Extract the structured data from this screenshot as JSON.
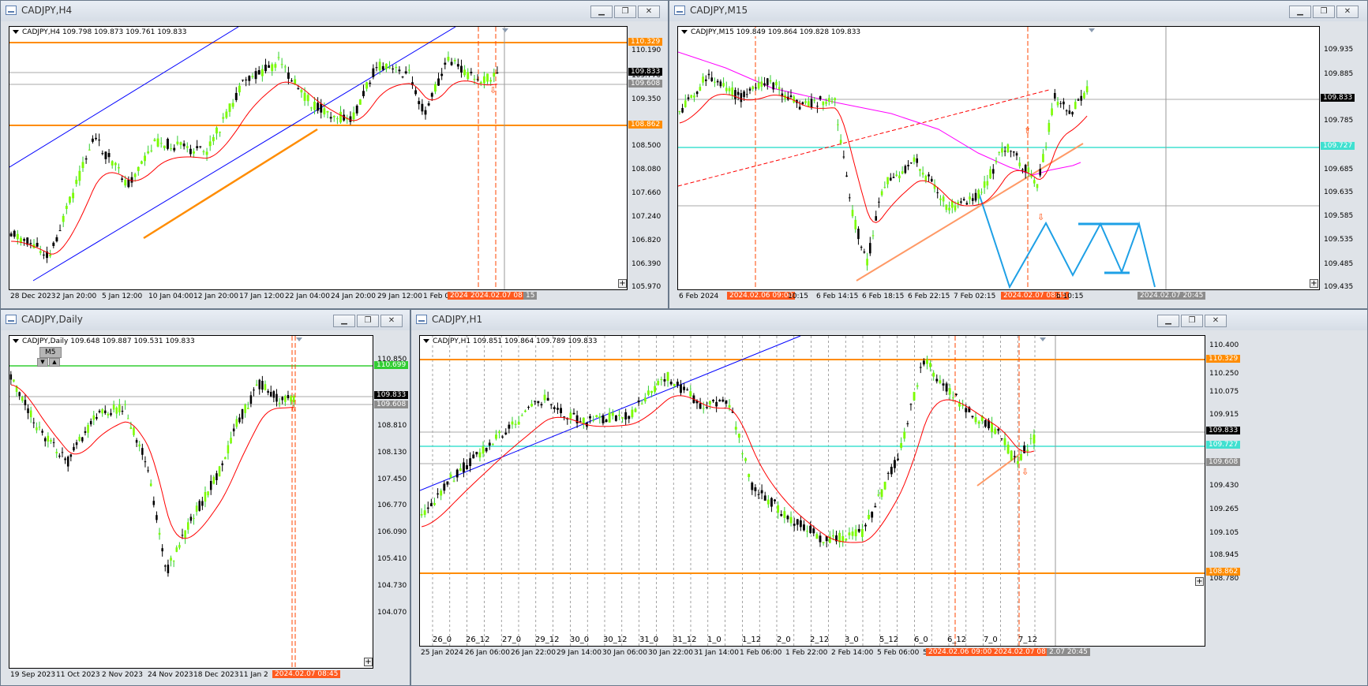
{
  "windows": [
    {
      "id": "h4",
      "title": "CADJPY,H4",
      "header": "CADJPY,H4  109.798 109.873 109.761 109.833",
      "ticks": [
        "110.190",
        "109.770",
        "109.350",
        "108.930",
        "108.500",
        "108.080",
        "107.660",
        "107.240",
        "106.820",
        "106.390",
        "105.970"
      ],
      "price_labels": [
        {
          "text": "110.329",
          "kind": "orange"
        },
        {
          "text": "109.833",
          "kind": "black"
        },
        {
          "text": "109.608",
          "kind": "gray"
        },
        {
          "text": "108.862",
          "kind": "orange"
        }
      ],
      "xticks": [
        "28 Dec 2023",
        "2 Jan 20:00",
        "5 Jan 12:00",
        "10 Jan 04:00",
        "12 Jan 20:00",
        "17 Jan 12:00",
        "22 Jan 04:00",
        "24 Jan 20:00",
        "29 Jan 12:00",
        "1 Feb 04"
      ],
      "xlabels": [
        {
          "text": "2024",
          "kind": "orange"
        },
        {
          "text": "2024.02.07 08:45",
          "kind": "orange"
        },
        {
          "text": "15",
          "kind": "gray"
        }
      ]
    },
    {
      "id": "m15",
      "title": "CADJPY,M15",
      "header": "CADJPY,M15  109.849 109.864 109.828 109.833",
      "ticks": [
        "109.935",
        "109.885",
        "109.835",
        "109.785",
        "109.735",
        "109.685",
        "109.635",
        "109.585",
        "109.535",
        "109.485",
        "109.435"
      ],
      "price_labels": [
        {
          "text": "109.833",
          "kind": "black"
        },
        {
          "text": "109.727",
          "kind": "cyan"
        }
      ],
      "xticks": [
        "6 Feb 2024",
        "10:15",
        "6 Feb 14:15",
        "6 Feb 18:15",
        "6 Feb 22:15",
        "7 Feb 02:15",
        "b 10:15"
      ],
      "xlabels": [
        {
          "text": "2024.02.06 09:00",
          "kind": "orange"
        },
        {
          "text": "2024.02.07 08:45",
          "kind": "orange"
        },
        {
          "text": "2024.02.07 20:45",
          "kind": "gray"
        }
      ]
    },
    {
      "id": "daily",
      "title": "CADJPY,Daily",
      "header": "CADJPY,Daily  109.648 109.887 109.531 109.833",
      "ticks": [
        "110.850",
        "110.170",
        "109.490",
        "108.810",
        "108.130",
        "107.450",
        "106.770",
        "106.090",
        "105.410",
        "104.730",
        "104.070"
      ],
      "price_labels": [
        {
          "text": "110.699",
          "kind": "green"
        },
        {
          "text": "109.833",
          "kind": "black"
        },
        {
          "text": "109.608",
          "kind": "gray"
        }
      ],
      "xticks": [
        "19 Sep 2023",
        "11 Oct 2023",
        "2 Nov 2023",
        "24 Nov 2023",
        "18 Dec 2023",
        "11 Jan 2"
      ],
      "xlabels": [
        {
          "text": "2024.02.07 08:45",
          "kind": "orange"
        }
      ],
      "m5": "M5"
    },
    {
      "id": "h1",
      "title": "CADJPY,H1",
      "header": "CADJPY,H1  109.851 109.864 109.789 109.833",
      "ticks": [
        "110.400",
        "110.250",
        "110.075",
        "109.915",
        "109.750",
        "109.590",
        "109.430",
        "109.265",
        "109.105",
        "108.945",
        "108.780"
      ],
      "price_labels": [
        {
          "text": "110.329",
          "kind": "orange"
        },
        {
          "text": "109.833",
          "kind": "black"
        },
        {
          "text": "109.727",
          "kind": "cyan"
        },
        {
          "text": "109.608",
          "kind": "gray"
        },
        {
          "text": "108.862",
          "kind": "orange"
        }
      ],
      "session_labels": [
        "26_0",
        "26_12",
        "27_0",
        "29_12",
        "30_0",
        "30_12",
        "31_0",
        "31_12",
        "1_0",
        "1_12",
        "2_0",
        "2_12",
        "3_0",
        "5_12",
        "6_0",
        "6_12",
        "7_0",
        "7_12"
      ],
      "xticks": [
        "25 Jan 2024",
        "26 Jan 06:00",
        "26 Jan 22:00",
        "29 Jan 14:00",
        "30 Jan 06:00",
        "30 Jan 22:00",
        "31 Jan 14:00",
        "1 Feb 06:00",
        "1 Feb 22:00",
        "2 Feb 14:00",
        "5 Feb 06:00",
        "5"
      ],
      "xlabels": [
        {
          "text": "2024.02.06 09:00",
          "kind": "orange"
        },
        {
          "text": "2024.02.07 08:45",
          "kind": "orange"
        },
        {
          "text": "2.07 20:45",
          "kind": "gray"
        }
      ]
    }
  ],
  "colors": {
    "orange": "#ff8c00",
    "black": "#000000",
    "gray": "#8c8c8c",
    "cyan": "#40e0d0",
    "green": "#32cd32",
    "bull": "#7cfc00",
    "bear": "#000000",
    "ma": "#ff0000",
    "trend": "#0000ff"
  },
  "icons": [
    "minimize-icon",
    "restore-icon",
    "close-icon"
  ]
}
